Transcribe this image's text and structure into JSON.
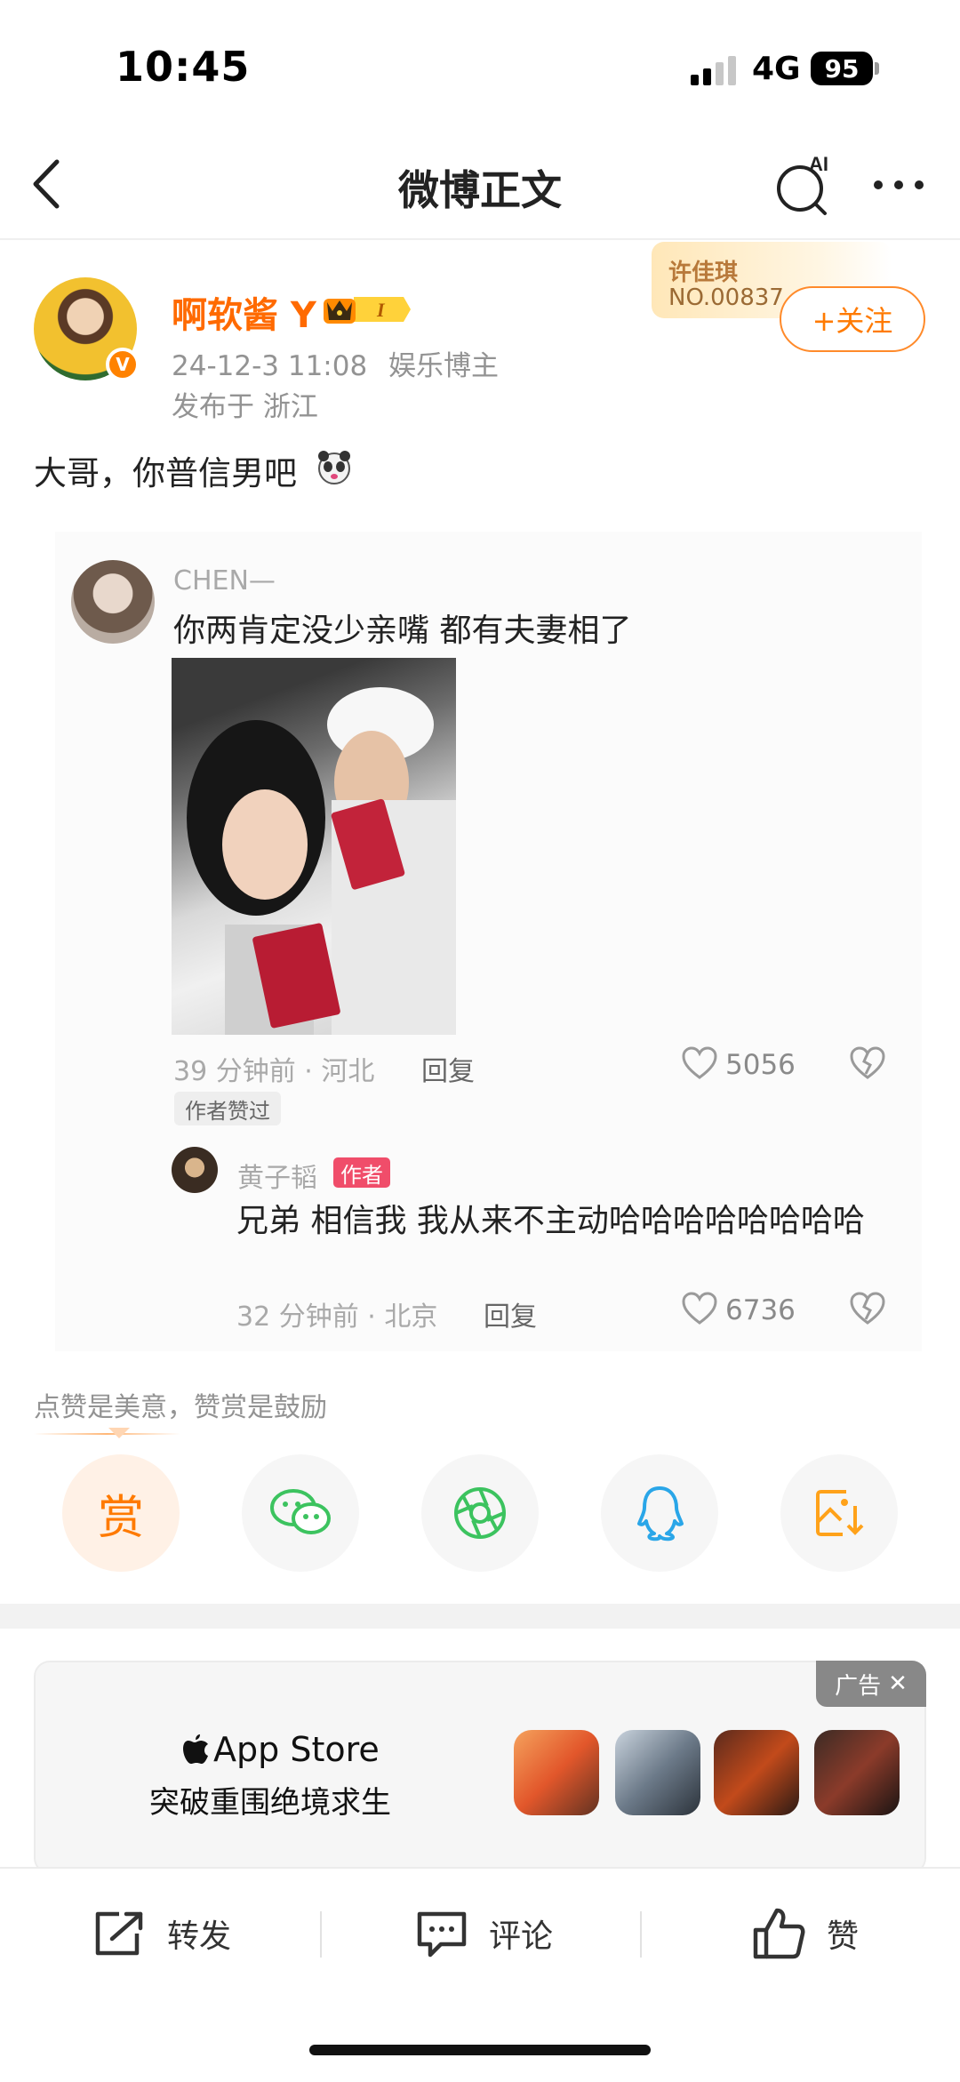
{
  "status_bar": {
    "time": "10:45",
    "network": "4G",
    "battery": "95"
  },
  "nav": {
    "title": "微博正文",
    "ai_label": "AI"
  },
  "author": {
    "name": "啊软酱 Y",
    "level_badge": "I",
    "post_time": "24-12-3 11:08",
    "category": "娱乐博主",
    "location": "发布于 浙江"
  },
  "fan_card": {
    "name": "许佳琪",
    "number": "NO.00837"
  },
  "follow_button": "+关注",
  "post": {
    "text": "大哥，你普信男吧"
  },
  "embedded": {
    "comment1": {
      "user": "CHEN—",
      "text": "你两肯定没少亲嘴 都有夫妻相了",
      "meta": "39 分钟前 · 河北",
      "reply_label": "回复",
      "likes": "5056",
      "author_liked": "作者赞过"
    },
    "comment2": {
      "user": "黄子韬",
      "badge": "作者",
      "text": "兄弟 相信我 我从来不主动哈哈哈哈哈哈哈哈",
      "meta": "32 分钟前 · 北京",
      "reply_label": "回复",
      "likes": "6736"
    }
  },
  "reward": {
    "hint": "点赞是美意，赞赏是鼓励",
    "reward_label": "赏"
  },
  "share_icons": [
    "reward-icon",
    "wechat-icon",
    "moments-icon",
    "qq-icon",
    "save-image-icon"
  ],
  "ad": {
    "tag": "广告",
    "store": "App Store",
    "slogan": "突破重围绝境求生"
  },
  "toolbar": {
    "repost": "转发",
    "comment": "评论",
    "like": "赞"
  },
  "colors": {
    "brand_orange": "#ff7a00",
    "author_badge": "#f04d6a",
    "wechat_green": "#3cc35f",
    "qq_blue": "#2aa6e8",
    "save_orange": "#ffa21a"
  }
}
